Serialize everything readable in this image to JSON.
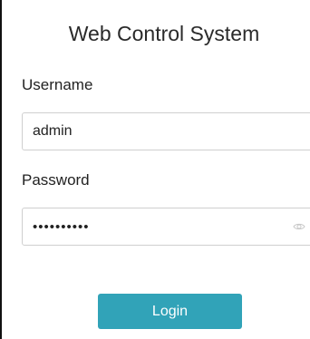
{
  "app": {
    "title": "Web Control System"
  },
  "form": {
    "username_label": "Username",
    "username_value": "admin",
    "password_label": "Password",
    "password_value": "••••••••••",
    "password_toggle_icon": "eye-icon",
    "login_label": "Login"
  },
  "colors": {
    "accent": "#31a3b8",
    "text": "#222222",
    "border": "#cfcfcf"
  }
}
